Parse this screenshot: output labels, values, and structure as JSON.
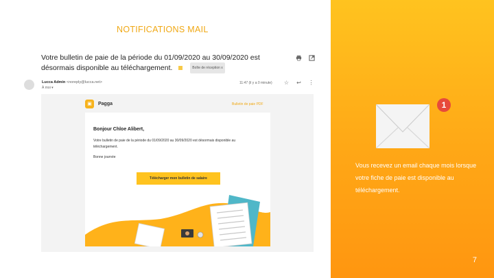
{
  "slide": {
    "title": "NOTIFICATIONS MAIL",
    "page_number": "7"
  },
  "side_panel": {
    "badge_count": "1",
    "description": "Vous recevez un email chaque mois lorsque votre fiche de paie est disponible au téléchargement."
  },
  "email": {
    "subject": "Votre bulletin de paie de la période du 01/09/2020 au 30/09/2020 est désormais disponible au téléchargement.",
    "label": "Boîte de réception x",
    "sender_name": "Lucca Admin",
    "sender_email": "<noreply@lucca.net>",
    "recipient": "À moi ▾",
    "time": "11:47 (il y a 0 minute)",
    "body": {
      "brand": "Pagga",
      "pdf_link": "Bulletin de paie PDF",
      "greeting": "Bonjour Chloe Alibert,",
      "message": "Votre bulletin de paie de la période du 01/09/2020 au 30/09/2020 est désormais disponible au téléchargement.",
      "closing": "Bonne journée",
      "download_button": "Télécharger mon bulletin de salaire"
    }
  },
  "colors": {
    "accent": "#f0a814",
    "panel_top": "#ffc31f",
    "panel_bottom": "#ff9610",
    "badge": "#e74a3b"
  },
  "icons": [
    "envelope-icon",
    "print-icon",
    "open-new-window-icon",
    "star-icon",
    "reply-icon",
    "more-icon"
  ]
}
